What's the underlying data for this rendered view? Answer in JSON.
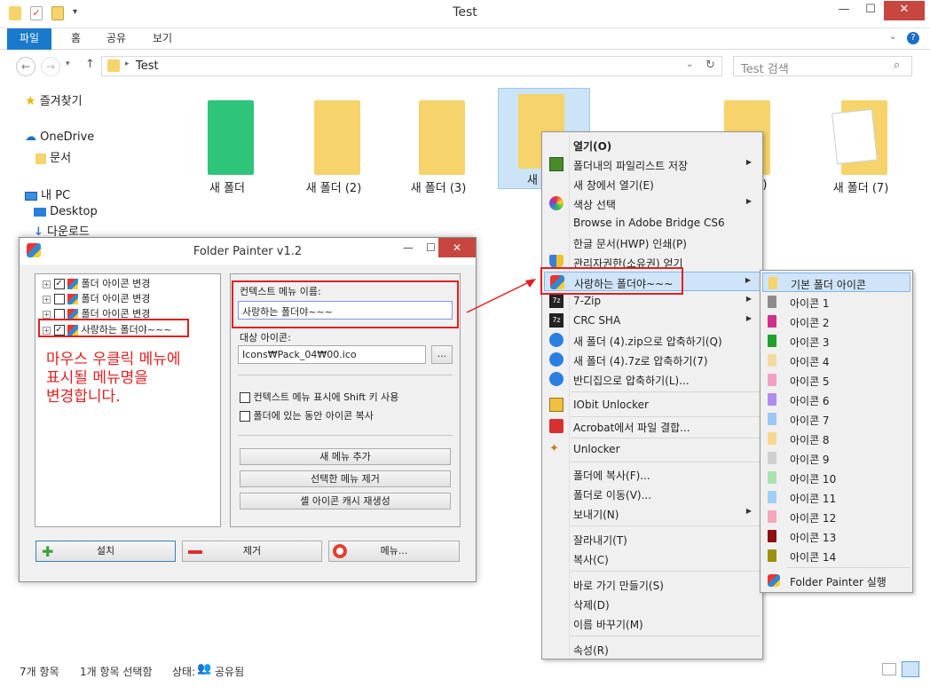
{
  "window": {
    "title": "Test"
  },
  "ribbon": {
    "tabs": [
      "파일",
      "홈",
      "공유",
      "보기"
    ]
  },
  "address": {
    "path": "Test",
    "search_placeholder": "Test 검색"
  },
  "sidebar": {
    "favorites": "즐겨찾기",
    "onedrive": "OneDrive",
    "documents": "문서",
    "thispc": "내 PC",
    "desktop": "Desktop",
    "downloads": "다운로드"
  },
  "files": [
    {
      "name": "새 폴더",
      "color": "#2ec47a"
    },
    {
      "name": "새 폴더 (2)",
      "color": "#f6d36b"
    },
    {
      "name": "새 폴더 (3)",
      "color": "#f6d36b"
    },
    {
      "name": "새 폴더",
      "color": "#f6d36b"
    },
    {
      "name": "(6)",
      "color": "#f6d36b"
    },
    {
      "name": "새 폴더 (7)",
      "color": "#f6d36b"
    }
  ],
  "status": {
    "items": "7개 항목",
    "selected": "1개 항목 선택함",
    "state_label": "상태:",
    "state_value": "공유됨"
  },
  "dialog": {
    "title": "Folder Painter v1.2",
    "tree": [
      "폴더 아이콘 변경",
      "폴더 아이콘 변경",
      "폴더 아이콘 변경",
      "사랑하는 폴더야~~~"
    ],
    "tree_checked": [
      true,
      false,
      false,
      true
    ],
    "annotation": [
      "마우스 우클릭 메뉴에",
      "표시될 메뉴명을",
      "변경합니다."
    ],
    "menu_name_label": "컨텍스트 메뉴 이름:",
    "menu_name_value": "사랑하는 폴더야~~~",
    "icon_label": "대상 아이콘:",
    "icon_value": "Icons₩Pack_04₩00.ico",
    "browse": "...",
    "opt_shift": "컨텍스트 메뉴 표시에 Shift 키 사용",
    "opt_copy": "폴더에 있는 동안 아이콘 복사",
    "btn_add_menu": "새 메뉴 추가",
    "btn_remove_menu": "선택한 메뉴 제거",
    "btn_rebuild": "셸 아이콘 캐시 재생성",
    "btn_install": "설치",
    "btn_uninstall": "제거",
    "btn_menu": "메뉴..."
  },
  "context_menu": {
    "items": [
      {
        "label": "열기(O)",
        "bold": true
      },
      {
        "label": "폴더내의 파일리스트 저장",
        "arrow": true
      },
      {
        "label": "새 창에서 열기(E)"
      },
      {
        "label": "색상 선택",
        "arrow": true
      },
      {
        "label": "Browse in Adobe Bridge CS6"
      },
      {
        "label": "한글 문서(HWP) 인쇄(P)"
      },
      {
        "label": "관리자권한(소유권) 얻기"
      },
      {
        "label": "사랑하는 폴더야~~~",
        "arrow": true,
        "hot": true
      },
      {
        "label": "7-Zip",
        "arrow": true
      },
      {
        "label": "CRC SHA",
        "arrow": true
      },
      {
        "label": "새 폴더 (4).zip으로 압축하기(Q)"
      },
      {
        "label": "새 폴더 (4).7z로 압축하기(7)"
      },
      {
        "label": "반디집으로 압축하기(L)..."
      },
      {
        "label": "IObit Unlocker"
      },
      {
        "label": "Acrobat에서 파일 결합..."
      },
      {
        "label": "Unlocker"
      },
      {
        "label": "폴더에 복사(F)..."
      },
      {
        "label": "폴더로 이동(V)..."
      },
      {
        "label": "보내기(N)",
        "arrow": true
      },
      {
        "label": "잘라내기(T)"
      },
      {
        "label": "복사(C)"
      },
      {
        "label": "바로 가기 만들기(S)"
      },
      {
        "label": "삭제(D)"
      },
      {
        "label": "이름 바꾸기(M)"
      },
      {
        "label": "속성(R)"
      }
    ]
  },
  "submenu": {
    "items": [
      {
        "label": "기본 폴더 아이콘",
        "color": "#f6d36b"
      },
      {
        "label": "아이콘 1",
        "color": "#8c8c8c"
      },
      {
        "label": "아이콘 2",
        "color": "#d0308c"
      },
      {
        "label": "아이콘 3",
        "color": "#1ea02a"
      },
      {
        "label": "아이콘 4",
        "color": "#f5dba0"
      },
      {
        "label": "아이콘 5",
        "color": "#f2a0c8"
      },
      {
        "label": "아이콘 6",
        "color": "#b08cf0"
      },
      {
        "label": "아이콘 7",
        "color": "#9cc8f4"
      },
      {
        "label": "아이콘 8",
        "color": "#f8d890"
      },
      {
        "label": "아이콘 9",
        "color": "#d0d0d0"
      },
      {
        "label": "아이콘 10",
        "color": "#a8e4b0"
      },
      {
        "label": "아이콘 11",
        "color": "#a0d0f8"
      },
      {
        "label": "아이콘 12",
        "color": "#f4a8b8"
      },
      {
        "label": "아이콘 13",
        "color": "#8c1010"
      },
      {
        "label": "아이콘 14",
        "color": "#a09010"
      },
      {
        "label": "Folder Painter 실행",
        "color": "#c04070"
      }
    ]
  }
}
